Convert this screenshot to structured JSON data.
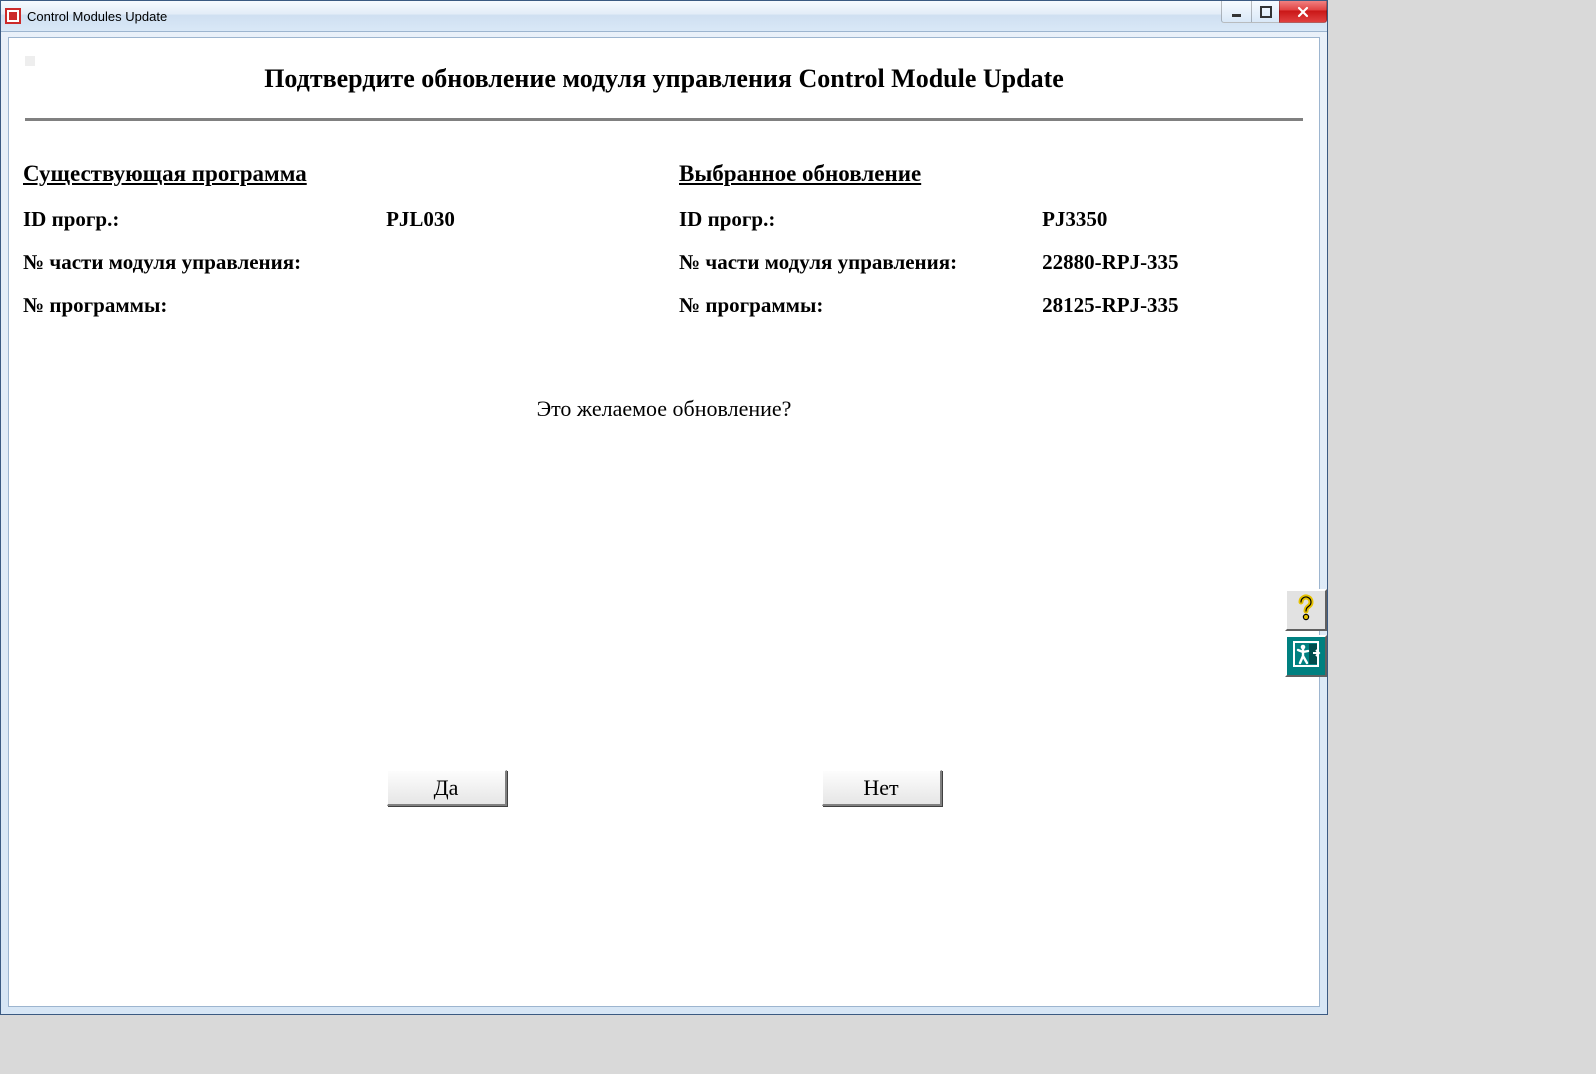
{
  "window": {
    "title": "Control Modules Update"
  },
  "page": {
    "heading": "Подтвердите обновление модуля управления Control Module Update",
    "current": {
      "section_label": "Существующая программа",
      "labels": {
        "prog_id": "ID прогр.:",
        "cm_part_no": "№ части модуля управления:",
        "prog_no": "№ программы:"
      },
      "values": {
        "prog_id": "PJL030",
        "cm_part_no": "",
        "prog_no": ""
      }
    },
    "update": {
      "section_label": "Выбранное обновление",
      "labels": {
        "prog_id": "ID прогр.:",
        "cm_part_no": "№ части модуля управления:",
        "prog_no": "№ программы:"
      },
      "values": {
        "prog_id": "PJ3350",
        "cm_part_no": "22880-RPJ-335",
        "prog_no": "28125-RPJ-335"
      }
    },
    "confirm_prompt": "Это желаемое обновление?",
    "buttons": {
      "yes": "Да",
      "no": "Нет"
    }
  },
  "icons": {
    "help": "help-icon",
    "exit": "exit-icon"
  }
}
